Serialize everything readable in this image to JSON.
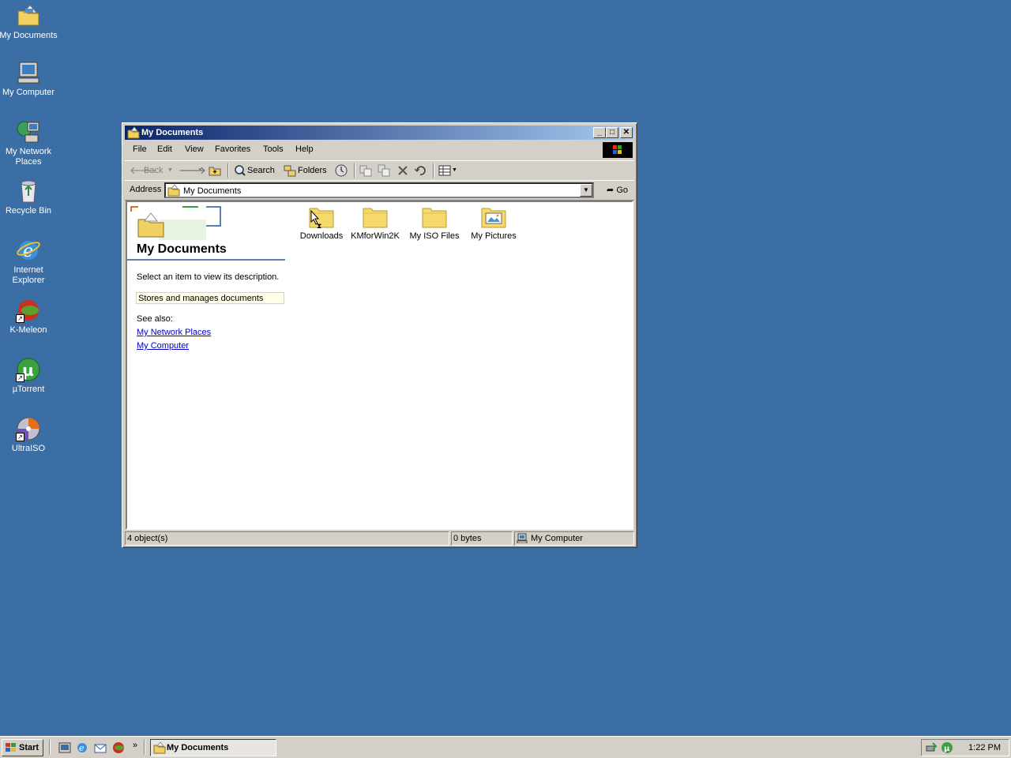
{
  "desktop": {
    "background": "#3a6ea5",
    "icons": [
      {
        "label": "My Documents",
        "icon": "my-documents-icon"
      },
      {
        "label": "My Computer",
        "icon": "my-computer-icon"
      },
      {
        "label": "My Network Places",
        "icon": "network-places-icon"
      },
      {
        "label": "Recycle Bin",
        "icon": "recycle-bin-icon"
      },
      {
        "label": "Internet Explorer",
        "icon": "internet-explorer-icon"
      },
      {
        "label": "K-Meleon",
        "icon": "k-meleon-icon"
      },
      {
        "label": "µTorrent",
        "icon": "utorrent-icon"
      },
      {
        "label": "UltraISO",
        "icon": "ultraiso-icon"
      }
    ]
  },
  "window": {
    "title": "My Documents",
    "menu": [
      "File",
      "Edit",
      "View",
      "Favorites",
      "Tools",
      "Help"
    ],
    "toolbar": {
      "back": "Back",
      "search": "Search",
      "folders": "Folders"
    },
    "address": {
      "label": "Address",
      "value": "My Documents",
      "go": "Go"
    },
    "left_pane": {
      "title": "My Documents",
      "description": "Select an item to view its description.",
      "info": "Stores and manages documents",
      "see_also": "See also:",
      "links": [
        "My Network Places",
        "My Computer"
      ]
    },
    "files": [
      {
        "name": "Downloads",
        "icon": "folder-icon"
      },
      {
        "name": "KMforWin2K",
        "icon": "folder-icon"
      },
      {
        "name": "My ISO Files",
        "icon": "folder-icon"
      },
      {
        "name": "My Pictures",
        "icon": "pictures-folder-icon"
      }
    ],
    "status": {
      "objects": "4 object(s)",
      "size": "0 bytes",
      "zone": "My Computer"
    }
  },
  "taskbar": {
    "start": "Start",
    "chevron": "»",
    "task": "My Documents",
    "clock": "1:22 PM"
  }
}
